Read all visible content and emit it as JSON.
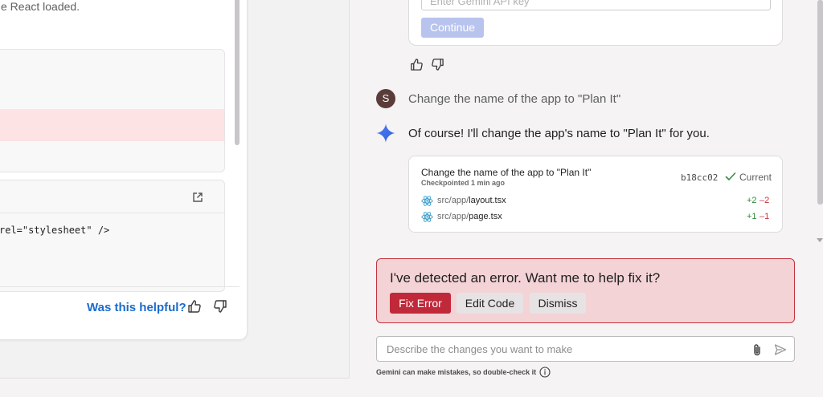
{
  "left_panel": {
    "doc_text": "e React loaded.",
    "code_snippet": "rel=\"stylesheet\" />",
    "helpful_label": "Was this helpful?",
    "open_icon": "external-link-icon",
    "thumbs_up_icon": "thumbs-up-icon",
    "thumbs_down_icon": "thumbs-down-icon"
  },
  "api_key": {
    "placeholder": "Enter Gemini API key",
    "continue_label": "Continue"
  },
  "chat": {
    "user_initial": "S",
    "user_message": "Change the name of the app to \"Plan It\"",
    "ai_message": "Of course! I'll change the app's name to \"Plan It\" for you."
  },
  "checkpoint": {
    "title": "Change the name of the app to \"Plan It\"",
    "subtitle": "Checkpointed 1 min ago",
    "hash": "b18cc02",
    "status": "Current",
    "files": [
      {
        "dir": "src/app/",
        "name": "layout.tsx",
        "additions": "+2",
        "deletions": "–2"
      },
      {
        "dir": "src/app/",
        "name": "page.tsx",
        "additions": "+1",
        "deletions": "–1"
      }
    ]
  },
  "error_banner": {
    "message": "I've detected an error. Want me to help fix it?",
    "fix_label": "Fix Error",
    "edit_label": "Edit Code",
    "dismiss_label": "Dismiss"
  },
  "prompt": {
    "placeholder": "Describe the changes you want to make",
    "disclaimer": "Gemini can make mistakes, so double-check it"
  },
  "colors": {
    "accent_blue": "#1a6bcc",
    "error_red": "#c0293a",
    "error_bg": "#f3d3d6",
    "diff_add": "#2e8b3a",
    "diff_del": "#c4313b",
    "avatar_bg": "#5a3d3a"
  }
}
